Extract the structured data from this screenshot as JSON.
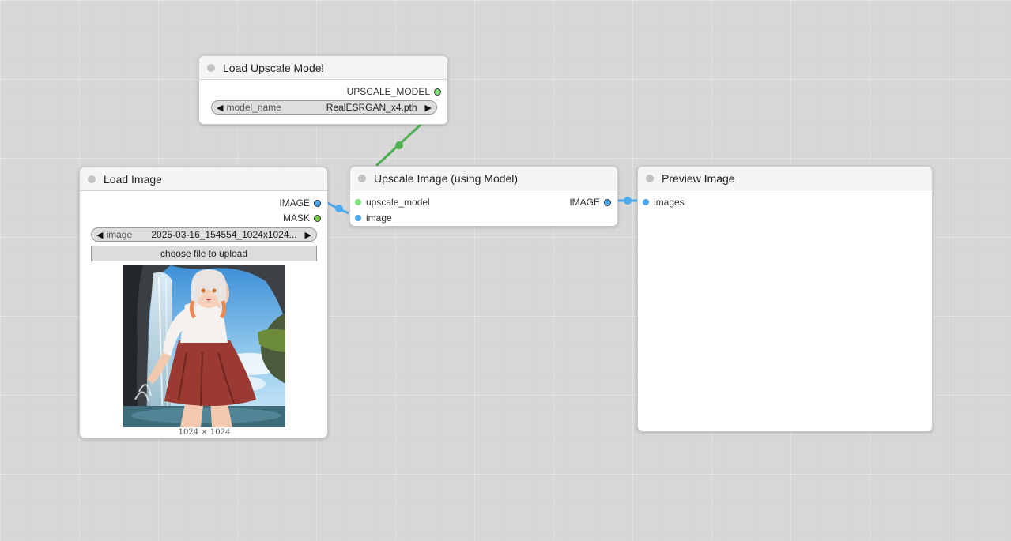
{
  "nodes": {
    "load_upscale_model": {
      "title": "Load Upscale Model",
      "output_label": "UPSCALE_MODEL",
      "widget_label": "model_name",
      "widget_value": "RealESRGAN_x4.pth"
    },
    "load_image": {
      "title": "Load Image",
      "outputs": [
        "IMAGE",
        "MASK"
      ],
      "widget_label": "image",
      "widget_value": "2025-03-16_154554_1024x1024...",
      "upload_label": "choose file to upload",
      "image_size": "1024 × 1024"
    },
    "upscale_image": {
      "title": "Upscale Image (using Model)",
      "inputs": [
        "upscale_model",
        "image"
      ],
      "output_label": "IMAGE"
    },
    "preview_image": {
      "title": "Preview Image",
      "input_label": "images"
    }
  },
  "colors": {
    "image_slot": "#4ea8ec",
    "mask_slot": "#81c84e",
    "upscale_model_slot": "#7fe07a",
    "model_link": "#4caf50",
    "image_link": "#4ea8ec"
  },
  "icons": {
    "combo_left": "triangle-left",
    "combo_right": "triangle-right"
  }
}
